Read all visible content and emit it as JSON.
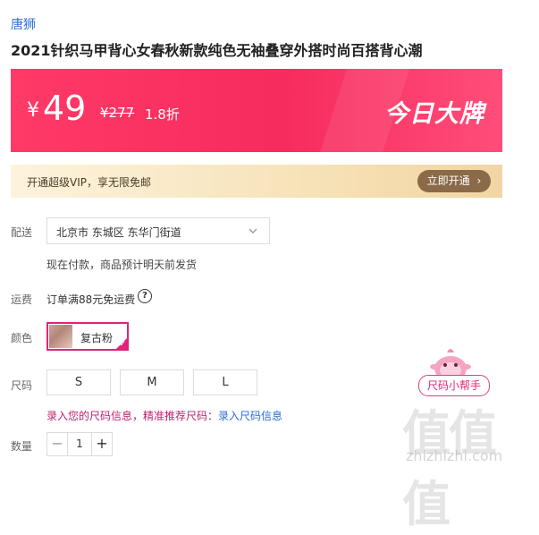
{
  "shop": {
    "name": "唐狮"
  },
  "product": {
    "title": "2021针织马甲背心女春秋新款纯色无袖叠穿外搭时尚百搭背心潮"
  },
  "price": {
    "currency": "¥",
    "current": "49",
    "original": "¥277",
    "discount": "1.8折",
    "badge": "今日大牌"
  },
  "vip": {
    "text": "开通超级VIP，享无限免邮",
    "button": "立即开通",
    "button_icon": "chevron-right-icon"
  },
  "delivery": {
    "label": "配送",
    "region": "北京市 东城区 东华门街道",
    "note": "现在付款，商品预计明天前发货"
  },
  "shipping": {
    "label": "运费",
    "text": "订单满88元免运费",
    "help_icon": "?"
  },
  "color": {
    "label": "颜色",
    "selected": "复古粉"
  },
  "size": {
    "label": "尺码",
    "options": [
      "S",
      "M",
      "L"
    ],
    "hint": "录入您的尺码信息，精准推荐尺码：",
    "hint_link": "录入尺码信息",
    "assistant": "尺码小帮手"
  },
  "quantity": {
    "label": "数量",
    "value": "1",
    "minus": "−",
    "plus": "+"
  },
  "watermark": {
    "main": "值值值",
    "sub": "zhizhizhi.com"
  },
  "colors": {
    "accent": "#ff3a67",
    "link": "#2a6ed3",
    "selected_border": "#e0237a"
  }
}
